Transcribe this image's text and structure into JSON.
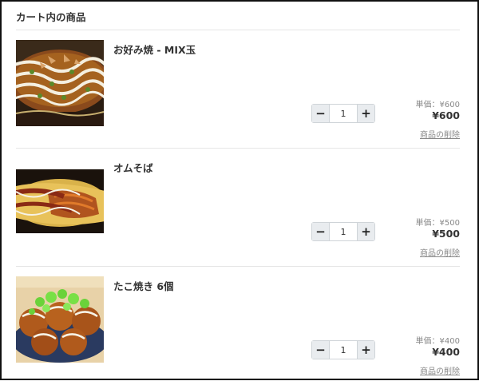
{
  "cart": {
    "title": "カート内の商品",
    "items": [
      {
        "name": "お好み焼 - MIX玉",
        "quantity": "1",
        "unit_price": "単価：¥600",
        "total": "¥600",
        "delete_label": "商品の削除",
        "minus_label": "−",
        "plus_label": "+"
      },
      {
        "name": "オムそば",
        "quantity": "1",
        "unit_price": "単価：¥500",
        "total": "¥500",
        "delete_label": "商品の削除",
        "minus_label": "−",
        "plus_label": "+"
      },
      {
        "name": "たこ焼き 6個",
        "quantity": "1",
        "unit_price": "単価：¥400",
        "total": "¥400",
        "delete_label": "商品の削除",
        "minus_label": "−",
        "plus_label": "+"
      }
    ]
  }
}
